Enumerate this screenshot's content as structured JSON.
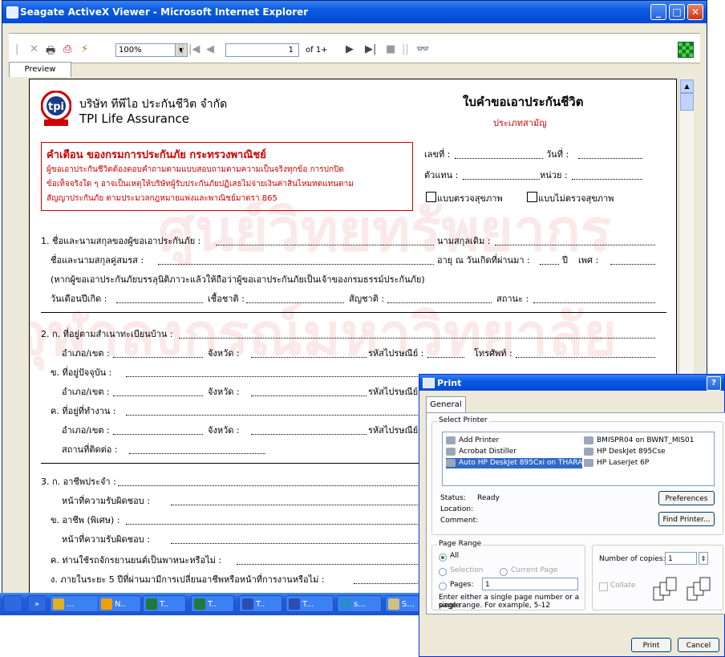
{
  "window": {
    "title": "Seagate ActiveX Viewer - Microsoft Internet Explorer"
  },
  "toolbar": {
    "zoom": "100%",
    "page_current": "1",
    "page_of": "of 1+"
  },
  "tab": {
    "preview": "Preview"
  },
  "report": {
    "company_th": "บริษัท ทีพีไอ ประกันชีวิต จำกัด",
    "company_en": "TPI Life Assurance",
    "logo_text": "tpi",
    "form_title": "ใบคำขอเอาประกันชีวิต",
    "form_subtitle": "ประเภทสามัญ",
    "warning": {
      "heading": "คำเตือน ของกรมการประกันภัย กระทรวงพาณิชย์",
      "lines": [
        "ผู้ขอเอาประกันชีวิตต้องตอบคำถามตามแบบสอบถามตามความเป็นจริงทุกข้อ การปกปิด",
        "ข้อเท็จจริงใด ๆ อาจเป็นเหตุให้บริษัทผู้รับประกันภัยปฏิเสธไม่จ่ายเงินค่าสินไหมทดแทนตาม",
        "สัญญาประกันภัย ตามประมวลกฎหมายแพ่งและพาณิชย์มาตรา 865"
      ]
    },
    "right_fields": {
      "no": "เลขที่ :",
      "date": "วันที่ :",
      "agent": "ตัวแทน :",
      "unit": "หน่วย :"
    },
    "checks": {
      "medical": "แบบตรวจสุขภาพ",
      "non_medical": "แบบไม่ตรวจสุขภาพ"
    },
    "s1": {
      "name": "1. ชื่อและนามสกุลของผู้ขอเอาประกันภัย :",
      "former_surname": "นามสกุลเดิม :",
      "spouse": "ชื่อและนามสกุลคู่สมรส :",
      "age": "อายุ ณ วันเกิดที่ผ่านมา :",
      "year": "ปี",
      "sex": "เพศ :",
      "note": "(หากผู้ขอเอาประกันภัยบรรลุนิติภาวะแล้วให้ถือว่าผู้ขอเอาประกันภัยเป็นเจ้าของกรมธรรม์ประกันภัย)",
      "dob": "วันเดือนปีเกิด :",
      "race": "เชื้อชาติ :",
      "nationality": "สัญชาติ :",
      "status": "สถานะ :"
    },
    "s2": {
      "a": "2. ก. ที่อยู่ตามสำเนาทะเบียนบ้าน :",
      "district": "อำเภอ/เขต :",
      "province": "จังหวัด :",
      "postcode": "รหัสไปรษณีย์ :",
      "phone": "โทรศัพท์ :",
      "b": "ข. ที่อยู่ปัจจุบัน :",
      "c": "ค. ที่อยู่ที่ทำงาน :",
      "contact": "สถานที่ติดต่อ :"
    },
    "s3": {
      "a": "3. ก. อาชีพประจำ :",
      "duty": "หน้าที่ความรับผิดชอบ :",
      "b": "ข. อาชีพ (พิเศษ) :",
      "c": "ค. ท่านใช้รถจักรยานยนต์เป็นพาหนะหรือไม่ :",
      "d": "ง. ภายในระยะ 5 ปีที่ผ่านมามีการเปลี่ยนอาชีพหรือหน้าที่การงานหรือไม่ :"
    },
    "watermark": [
      "ศูนย์วิทยทรัพยากร",
      "จุฬาลงกรณ์มหาวิทยาลัย"
    ]
  },
  "taskbar": {
    "items": [
      "...",
      "N..",
      "T..",
      "T..",
      "T..",
      "T...",
      "s...",
      "S..."
    ]
  },
  "print_dialog": {
    "title": "Print",
    "tab": "General",
    "select_printer": "Select Printer",
    "printers": [
      "Add Printer",
      "Acrobat Distiller",
      "Auto HP DeskJet 895Cxi on THARA",
      "BMISPR04 on BWNT_MIS01",
      "HP DeskJet 895Cse",
      "HP LaserJet 6P"
    ],
    "status_label": "Status:",
    "status_value": "Ready",
    "location_label": "Location:",
    "comment_label": "Comment:",
    "preferences": "Preferences",
    "find_printer": "Find Printer...",
    "page_range": "Page Range",
    "all": "All",
    "selection": "Selection",
    "current_page": "Current Page",
    "pages": "Pages:",
    "pages_value": "1",
    "hint": [
      "Enter either a single page number or a single",
      "page range.  For example, 5-12"
    ],
    "copies_label": "Number of copies:",
    "copies_value": "1",
    "collate": "Collate",
    "print": "Print",
    "cancel": "Cancel"
  }
}
